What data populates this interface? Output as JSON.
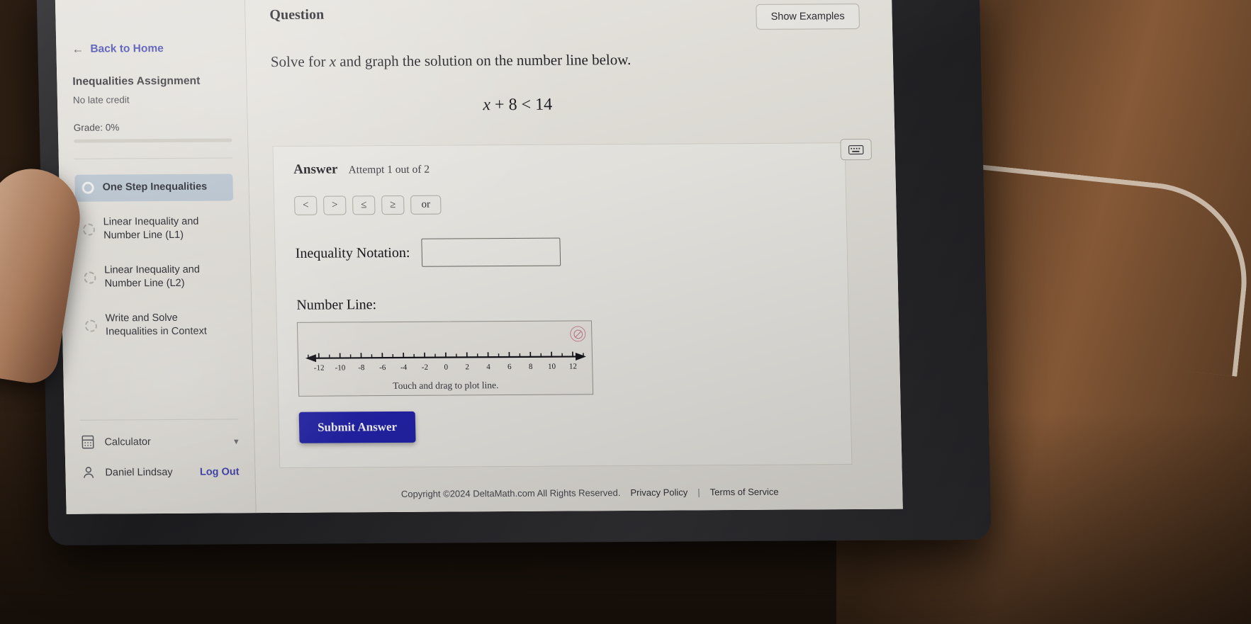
{
  "sidebar": {
    "back_home": "Back to Home",
    "back_icon": "arrow-left-icon",
    "assignment_title": "Inequalities Assignment",
    "late_credit": "No late credit",
    "grade": "Grade: 0%",
    "items": [
      {
        "label": "One Step Inequalities",
        "active": true
      },
      {
        "label": "Linear Inequality and Number Line (L1)",
        "active": false
      },
      {
        "label": "Linear Inequality and Number Line (L2)",
        "active": false
      },
      {
        "label": "Write and Solve Inequalities in Context",
        "active": false
      }
    ],
    "calculator_label": "Calculator",
    "calculator_icon": "calculator-icon",
    "calculator_chevron": "chevron-down-icon",
    "user_name": "Daniel Lindsay",
    "user_icon": "person-icon",
    "logout_label": "Log Out"
  },
  "main": {
    "question_title": "Question",
    "show_examples": "Show Examples",
    "prompt_part1": "Solve for ",
    "prompt_var": "x",
    "prompt_part2": " and graph the solution on the number line below.",
    "equation_var": "x",
    "equation_rest": " + 8 < 14",
    "answer_label": "Answer",
    "attempt_text": "Attempt 1 out of 2",
    "keyboard_icon": "keyboard-icon",
    "operators": [
      "<",
      ">",
      "≤",
      "≥"
    ],
    "or_label": "or",
    "notation_label": "Inequality Notation:",
    "notation_value": "",
    "notation_placeholder": "",
    "number_line_label": "Number Line:",
    "number_line_hint": "Touch and drag to plot line.",
    "number_line_tool_icon": "no-entry-icon",
    "submit_label": "Submit Answer"
  },
  "chart_data": {
    "type": "number-line",
    "title": "Number Line:",
    "xlim": [
      -13,
      13
    ],
    "major_ticks": [
      -12,
      -10,
      -8,
      -6,
      -4,
      -2,
      0,
      2,
      4,
      6,
      8,
      10,
      12
    ],
    "minor_ticks": [
      -13,
      -11,
      -9,
      -7,
      -5,
      -3,
      -1,
      1,
      3,
      5,
      7,
      9,
      11,
      13
    ],
    "tick_labels": [
      "-12",
      "-10",
      "-8",
      "-6",
      "-4",
      "-2",
      "0",
      "2",
      "4",
      "6",
      "8",
      "10",
      "12"
    ],
    "arrows": [
      "left",
      "right"
    ],
    "plotted_points": [],
    "plotted_segments": [],
    "grid": false,
    "hint": "Touch and drag to plot line."
  },
  "footer": {
    "copyright": "Copyright ©2024 DeltaMath.com All Rights Reserved.",
    "privacy": "Privacy Policy",
    "separator": "|",
    "terms": "Terms of Service"
  },
  "colors": {
    "link": "#3b3fae",
    "submit_bg": "#2424ad",
    "active_nav_bg": "#b9c6d2"
  }
}
